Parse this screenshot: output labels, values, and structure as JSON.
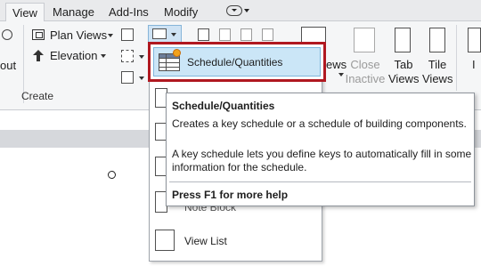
{
  "ribbon_tabs": [
    {
      "label": "View",
      "active": true
    },
    {
      "label": "Manage",
      "active": false
    },
    {
      "label": "Add-Ins",
      "active": false
    },
    {
      "label": "Modify",
      "active": false
    }
  ],
  "panel_create": {
    "label": "Create",
    "cut_off_label": "out",
    "plan_views": "Plan Views",
    "elevation": "Elevation"
  },
  "windows_panel": {
    "cut_off_button": "ews",
    "close_inactive": "Close\nInactive",
    "tab_views": "Tab\nViews",
    "tile_views": "Tile\nViews",
    "cut_off_right": "I"
  },
  "schedules_menu": {
    "highlighted_item": "Schedule/Quantities",
    "partial_item": "Note Block",
    "view_list": "View List"
  },
  "tooltip": {
    "title": "Schedule/Quantities",
    "description": "Creates a key schedule or a schedule of building components.",
    "detail": "A key schedule lets you define keys to automatically fill in some information for the schedule.",
    "help": "Press F1 for more help"
  },
  "colors": {
    "highlight_border": "#b01820",
    "highlight_fill": "#cbe6f7",
    "ribbon_bg": "#f5f6f7",
    "tab_bar_bg": "#e9eaec"
  }
}
